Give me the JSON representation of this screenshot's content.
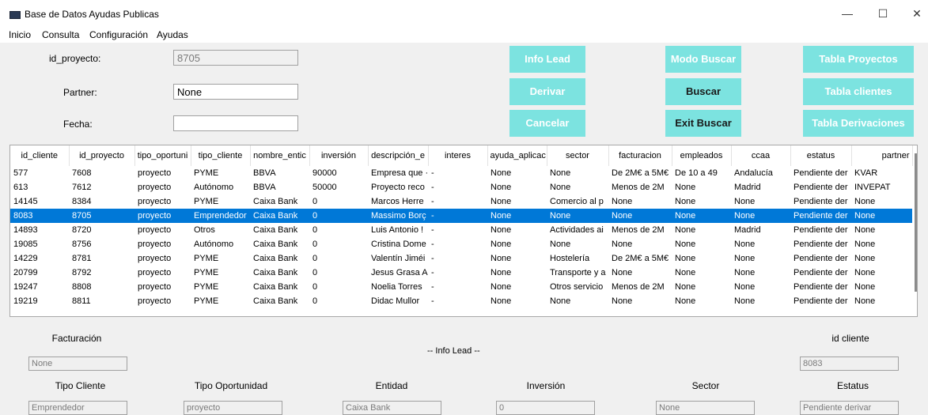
{
  "window": {
    "title": "Base de Datos Ayudas Publicas",
    "minimize": "—",
    "maximize": "☐",
    "close": "✕"
  },
  "menu": [
    "Inicio",
    "Consulta",
    "Configuración",
    "Ayudas"
  ],
  "form": {
    "id_proyecto": {
      "label": "id_proyecto:",
      "value": "8705"
    },
    "partner": {
      "label": "Partner:",
      "value": "None"
    },
    "fecha": {
      "label": "Fecha:",
      "value": ""
    }
  },
  "buttons": {
    "info_lead": "Info Lead",
    "modo_buscar": "Modo Buscar",
    "tabla_proyectos": "Tabla Proyectos",
    "derivar": "Derivar",
    "buscar": "Buscar",
    "tabla_clientes": "Tabla clientes",
    "cancelar": "Cancelar",
    "exit_buscar": "Exit Buscar",
    "tabla_derivaciones": "Tabla Derivaciones"
  },
  "colors": {
    "accent_button": "#7ce3e0",
    "selection": "#0078d7"
  },
  "table": {
    "columns": [
      "id_cliente",
      "id_proyecto",
      "tipo_oportuni",
      "tipo_cliente",
      "nombre_entic",
      "inversión",
      "descripción_e",
      "interes",
      "ayuda_aplicac",
      "sector",
      "facturacion",
      "empleados",
      "ccaa",
      "estatus",
      "partner"
    ],
    "selected_index": 3,
    "rows": [
      [
        "577",
        "7608",
        "proyecto",
        "PYME",
        "BBVA",
        "90000",
        "Empresa que ·",
        "-",
        "None",
        "None",
        "De 2M€ a 5M€",
        "De 10 a 49",
        "Andalucía",
        "Pendiente der",
        "KVAR"
      ],
      [
        "613",
        "7612",
        "proyecto",
        "Autónomo",
        "BBVA",
        "50000",
        "Proyecto reco",
        "-",
        "None",
        "None",
        "Menos de 2M",
        "None",
        "Madrid",
        "Pendiente der",
        "INVEPAT"
      ],
      [
        "14145",
        "8384",
        "proyecto",
        "PYME",
        "Caixa Bank",
        "0",
        "Marcos Herre",
        "-",
        "None",
        "Comercio al p",
        "None",
        "None",
        "None",
        "Pendiente der",
        "None"
      ],
      [
        "8083",
        "8705",
        "proyecto",
        "Emprendedor",
        "Caixa Bank",
        "0",
        "Massimo Borç",
        "-",
        "None",
        "None",
        "None",
        "None",
        "None",
        "Pendiente der",
        "None"
      ],
      [
        "14893",
        "8720",
        "proyecto",
        "Otros",
        "Caixa Bank",
        "0",
        "Luis Antonio !",
        "-",
        "None",
        "Actividades ai",
        "Menos de 2M",
        "None",
        "Madrid",
        "Pendiente der",
        "None"
      ],
      [
        "19085",
        "8756",
        "proyecto",
        "Autónomo",
        "Caixa Bank",
        "0",
        "Cristina Dome",
        "-",
        "None",
        "None",
        "None",
        "None",
        "None",
        "Pendiente der",
        "None"
      ],
      [
        "14229",
        "8781",
        "proyecto",
        "PYME",
        "Caixa Bank",
        "0",
        "Valentín Jiméi",
        "-",
        "None",
        "Hostelería",
        "De 2M€ a 5M€",
        "None",
        "None",
        "Pendiente der",
        "None"
      ],
      [
        "20799",
        "8792",
        "proyecto",
        "PYME",
        "Caixa Bank",
        "0",
        "Jesus Grasa A",
        "-",
        "None",
        "Transporte y a",
        "None",
        "None",
        "None",
        "Pendiente der",
        "None"
      ],
      [
        "19247",
        "8808",
        "proyecto",
        "PYME",
        "Caixa Bank",
        "0",
        "Noelia Torres",
        "-",
        "None",
        "Otros servicio",
        "Menos de 2M",
        "None",
        "None",
        "Pendiente der",
        "None"
      ],
      [
        "19219",
        "8811",
        "proyecto",
        "PYME",
        "Caixa Bank",
        "0",
        "Didac Mullor",
        "-",
        "None",
        "None",
        "None",
        "None",
        "None",
        "Pendiente der",
        "None"
      ]
    ]
  },
  "details": {
    "header": "-- Info Lead --",
    "facturacion": {
      "label": "Facturación",
      "value": "None"
    },
    "id_cliente": {
      "label": "id cliente",
      "value": "8083"
    },
    "tipo_cliente": {
      "label": "Tipo Cliente",
      "value": "Emprendedor"
    },
    "tipo_oportunidad": {
      "label": "Tipo Oportunidad",
      "value": "proyecto"
    },
    "entidad": {
      "label": "Entidad",
      "value": "Caixa Bank"
    },
    "inversion": {
      "label": "Inversión",
      "value": "0"
    },
    "sector": {
      "label": "Sector",
      "value": "None"
    },
    "estatus": {
      "label": "Estatus",
      "value": "Pendiente derivar"
    }
  }
}
